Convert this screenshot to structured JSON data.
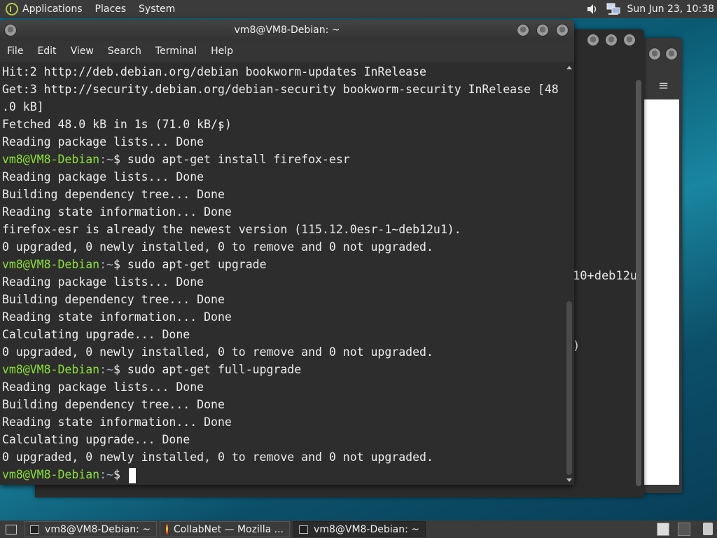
{
  "top_panel": {
    "menus": [
      "Applications",
      "Places",
      "System"
    ],
    "clock": "Sun Jun 23, 10:38"
  },
  "terminal": {
    "title": "vm8@VM8-Debian: ~",
    "menu": [
      "File",
      "Edit",
      "View",
      "Search",
      "Terminal",
      "Help"
    ],
    "lines": [
      {
        "text": "Hit:2 http://deb.debian.org/debian bookworm-updates InRelease"
      },
      {
        "text": "Get:3 http://security.debian.org/debian-security bookworm-security InRelease [48"
      },
      {
        "text": ".0 kB]"
      },
      {
        "text": "Fetched 48.0 kB in 1s (71.0 kB/s)"
      },
      {
        "text": "Reading package lists... Done"
      },
      {
        "user": "vm8@VM8-Debian",
        "sep": ":~",
        "cmd": "$ sudo apt-get install firefox-esr"
      },
      {
        "text": "Reading package lists... Done"
      },
      {
        "text": "Building dependency tree... Done"
      },
      {
        "text": "Reading state information... Done"
      },
      {
        "text": "firefox-esr is already the newest version (115.12.0esr-1~deb12u1)."
      },
      {
        "text": "0 upgraded, 0 newly installed, 0 to remove and 0 not upgraded."
      },
      {
        "user": "vm8@VM8-Debian",
        "sep": ":~",
        "cmd": "$ sudo apt-get upgrade"
      },
      {
        "text": "Reading package lists... Done"
      },
      {
        "text": "Building dependency tree... Done"
      },
      {
        "text": "Reading state information... Done"
      },
      {
        "text": "Calculating upgrade... Done"
      },
      {
        "text": "0 upgraded, 0 newly installed, 0 to remove and 0 not upgraded."
      },
      {
        "user": "vm8@VM8-Debian",
        "sep": ":~",
        "cmd": "$ sudo apt-get full-upgrade"
      },
      {
        "text": "Reading package lists... Done"
      },
      {
        "text": "Building dependency tree... Done"
      },
      {
        "text": "Reading state information... Done"
      },
      {
        "text": "Calculating upgrade... Done"
      },
      {
        "text": "0 upgraded, 0 newly installed, 0 to remove and 0 not upgraded."
      },
      {
        "user": "vm8@VM8-Debian",
        "sep": ":~",
        "cmd": "$ ",
        "cursor": true
      }
    ]
  },
  "background_window": {
    "fragment_1": "10+deb12u",
    "fragment_2": ")"
  },
  "taskbar": {
    "tasks": [
      {
        "label": "vm8@VM8-Debian: ~",
        "icon": "terminal-icon",
        "active": false
      },
      {
        "label": "CollabNet — Mozilla ...",
        "icon": "firefox-icon",
        "active": false
      },
      {
        "label": "vm8@VM8-Debian: ~",
        "icon": "terminal-icon",
        "active": true
      }
    ]
  },
  "colors": {
    "prompt_user": "#8ae234",
    "terminal_bg": "#2d2d2d",
    "panel_bg": "#3b3b3b"
  }
}
